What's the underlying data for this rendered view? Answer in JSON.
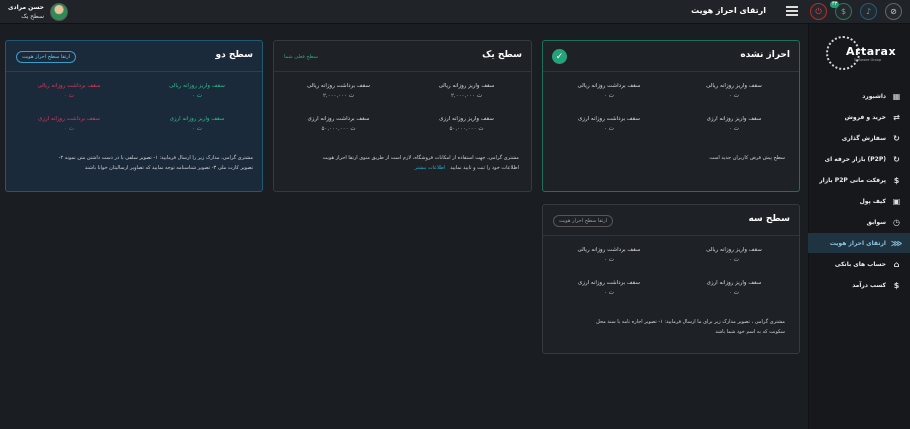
{
  "header": {
    "title": "ارتقای احراز هویت",
    "user_name": "حسن مرادی",
    "user_level": "سطح یک",
    "notif_count": "۴۳"
  },
  "sidebar": {
    "logo": "Artarax",
    "logo_sub": "Software Group",
    "items": [
      {
        "label": "داشبورد",
        "icon": "dashboard-icon"
      },
      {
        "label": "خرید و فروش",
        "icon": "swap-icon"
      },
      {
        "label": "سفارش گذاری",
        "icon": "sync-icon"
      },
      {
        "label": "بازار حرفه ای (P2P)",
        "icon": "sync-icon"
      },
      {
        "label": "بازار P2P پرفکت مانی",
        "icon": "dollar-icon"
      },
      {
        "label": "کیف پول",
        "icon": "wallet-icon"
      },
      {
        "label": "سوابق",
        "icon": "history-icon"
      },
      {
        "label": "ارتقای احراز هویت",
        "icon": "verify-icon",
        "active": true
      },
      {
        "label": "حساب های بانکی",
        "icon": "bank-icon"
      },
      {
        "label": "کسب درآمد",
        "icon": "dollar-icon"
      }
    ]
  },
  "cards": {
    "unverified": {
      "title": "احراز نشده",
      "stats": [
        {
          "label": "سقف واریز روزانه ریالی",
          "value": "۰ ت"
        },
        {
          "label": "سقف برداشت روزانه ریالی",
          "value": "۰ ت"
        },
        {
          "label": "سقف واریز روزانه ارزی",
          "value": "۰ ت"
        },
        {
          "label": "سقف برداشت روزانه ارزی",
          "value": "۰ ت"
        }
      ],
      "note": "سطح پیش فرض کاربران جدید است"
    },
    "level_one": {
      "title": "سطح یک",
      "status": "سطح فعلی شما",
      "stats": [
        {
          "label": "سقف واریز روزانه ریالی",
          "value": "۲,۰۰۰,۰۰۰ ت"
        },
        {
          "label": "سقف برداشت روزانه ریالی",
          "value": "۲,۰۰۰,۰۰۰ ت"
        },
        {
          "label": "سقف واریز روزانه ارزی",
          "value": "۵۰,۰۰۰,۰۰۰ ت"
        },
        {
          "label": "سقف برداشت روزانه ارزی",
          "value": "۵۰,۰۰۰,۰۰۰ ت"
        }
      ],
      "note_line1": "مشتری گرامی، جهت استفاده از امکانات فروشگاه، لازم است از طریق منوی ارتقا احراز هویت",
      "note_line2": "اطلاعات خود را ثبت و تایید نمایید",
      "note_link": "اطلاعات بیشتر"
    },
    "level_two": {
      "title": "سطح دو",
      "button": "ارتقا سطح احراز هویت",
      "stats": [
        {
          "label": "سقف واریز روزانه ریالی",
          "value": "۰ ت"
        },
        {
          "label": "سقف برداشت روزانه ریالی",
          "value": "۰ ت"
        },
        {
          "label": "سقف واریز روزانه ارزی",
          "value": "۰ ت"
        },
        {
          "label": "سقف برداشت روزانه ارزی",
          "value": "۰ ت"
        }
      ],
      "note_line1": "مشتری گرامی، مدارک زیر را ارسال فرمایید: ۱- تصویر سلفی با در دست داشتن متن نمونه ۲-",
      "note_line2": "تصویر کارت ملی ۳- تصویر شناسنامه  توجه نمایید که تصاویر ارسالیتان خوانا باشند"
    },
    "level_three": {
      "title": "سطح سه",
      "button": "ارتقا سطح احراز هویت",
      "stats": [
        {
          "label": "سقف واریز روزانه ریالی",
          "value": "۰ ت"
        },
        {
          "label": "سقف برداشت روزانه ریالی",
          "value": "۰ ت"
        },
        {
          "label": "سقف واریز روزانه ارزی",
          "value": "۰ ت"
        },
        {
          "label": "سقف برداشت روزانه ارزی",
          "value": "۰ ت"
        }
      ],
      "note_line1": "مشتری گرامی ، تصویر مدارک زیر برای ما ارسال فرمایید: ۱- تصویر اجاره نامه یا سند محل",
      "note_line2": "سکونت که به اسم خود شما باشد"
    }
  }
}
